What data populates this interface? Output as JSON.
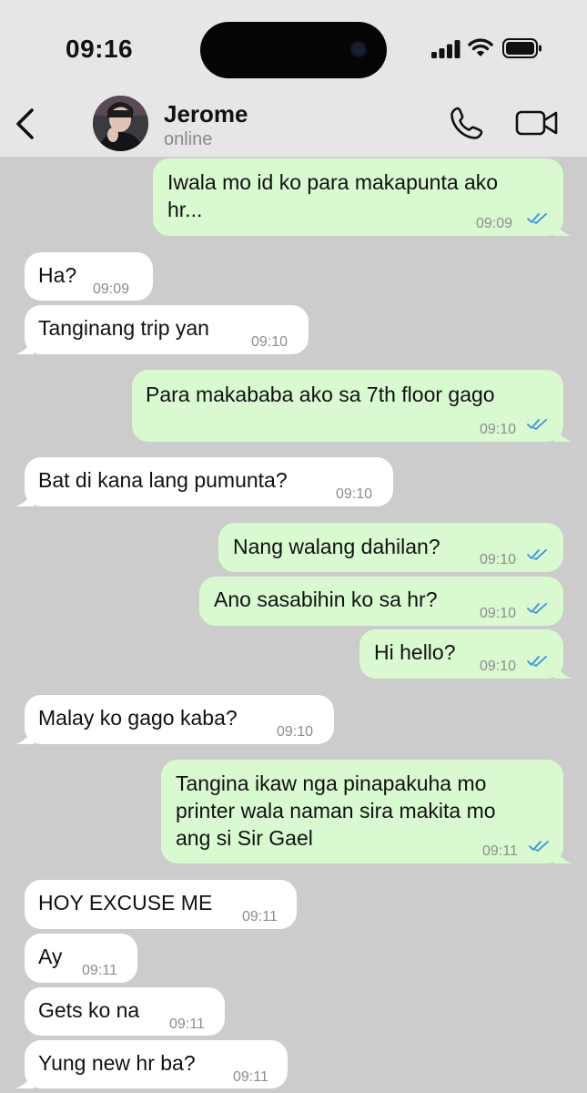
{
  "status_bar": {
    "time": "09:16"
  },
  "chat_header": {
    "contact_name": "Jerome",
    "presence": "online"
  },
  "colors": {
    "incoming_bubble": "#ffffff",
    "outgoing_bubble": "#d9fad1",
    "read_tick": "#3b8fd9",
    "chat_background": "#cccccc"
  },
  "messages": [
    {
      "direction": "out",
      "lines": [
        "Iwala mo id ko para makapunta ako",
        "hr..."
      ],
      "time": "09:09",
      "status": "read"
    },
    {
      "direction": "in",
      "lines": [
        "Ha?"
      ],
      "time": "09:09"
    },
    {
      "direction": "in",
      "lines": [
        "Tanginang trip yan"
      ],
      "time": "09:10"
    },
    {
      "direction": "out",
      "lines": [
        "Para makababa ako sa 7th floor gago"
      ],
      "time": "09:10",
      "status": "read"
    },
    {
      "direction": "in",
      "lines": [
        "Bat di kana lang pumunta?"
      ],
      "time": "09:10"
    },
    {
      "direction": "out",
      "lines": [
        "Nang walang dahilan?"
      ],
      "time": "09:10",
      "status": "read"
    },
    {
      "direction": "out",
      "lines": [
        "Ano sasabihin ko sa hr?"
      ],
      "time": "09:10",
      "status": "read"
    },
    {
      "direction": "out",
      "lines": [
        "Hi hello?"
      ],
      "time": "09:10",
      "status": "read"
    },
    {
      "direction": "in",
      "lines": [
        "Malay ko gago kaba?"
      ],
      "time": "09:10"
    },
    {
      "direction": "out",
      "lines": [
        "Tangina ikaw nga pinapakuha mo",
        "printer wala naman sira makita mo",
        "ang si Sir Gael"
      ],
      "time": "09:11",
      "status": "read"
    },
    {
      "direction": "in",
      "lines": [
        "HOY EXCUSE ME"
      ],
      "time": "09:11"
    },
    {
      "direction": "in",
      "lines": [
        "Ay"
      ],
      "time": "09:11"
    },
    {
      "direction": "in",
      "lines": [
        "Gets ko na"
      ],
      "time": "09:11"
    },
    {
      "direction": "in",
      "lines": [
        "Yung new hr ba?"
      ],
      "time": "09:11"
    }
  ]
}
